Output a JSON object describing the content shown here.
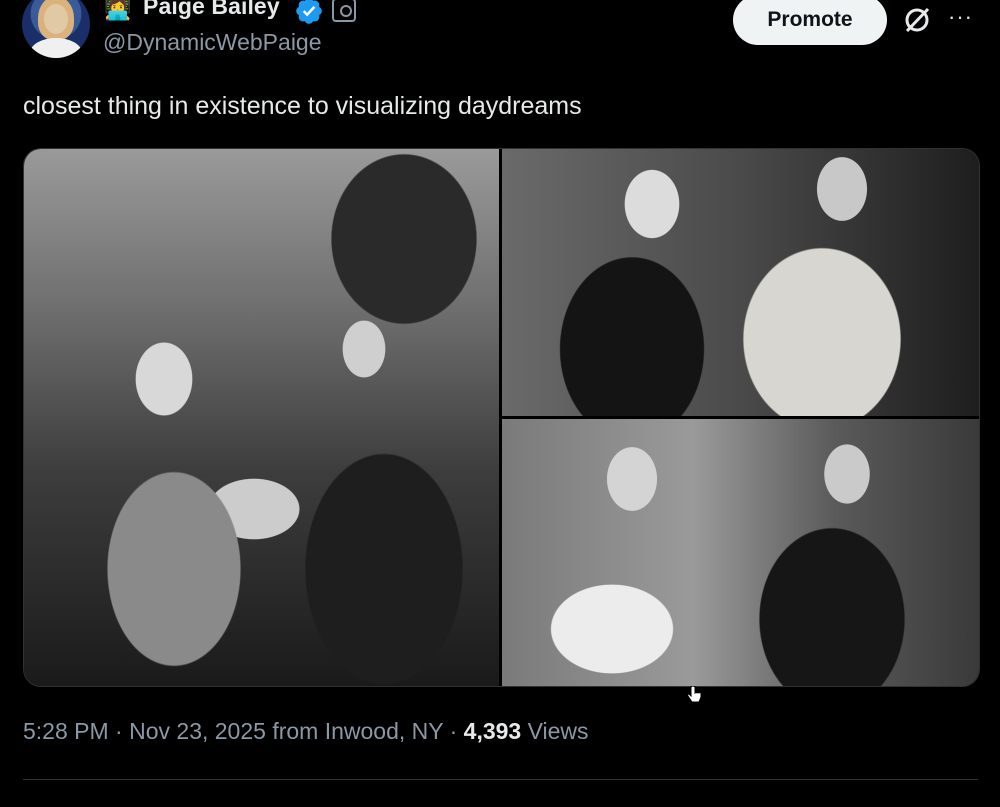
{
  "author": {
    "emoji": "👩‍💻",
    "name": "Paige Bailey",
    "handle": "@DynamicWebPaige"
  },
  "actions": {
    "promote_label": "Promote",
    "more_label": "···"
  },
  "tweet": {
    "text": "closest thing in existence to visualizing daydreams"
  },
  "meta": {
    "time": "5:28 PM",
    "sep1": "·",
    "date": "Nov 23, 2025",
    "location": "from Inwood, NY",
    "sep2": "·",
    "views_count": "4,393",
    "views_label": "Views"
  },
  "colors": {
    "background": "#000000",
    "text_primary": "#e7e9ea",
    "text_secondary": "#8b98a5",
    "verified": "#1d9bf0",
    "promote_bg": "#eff3f4"
  }
}
